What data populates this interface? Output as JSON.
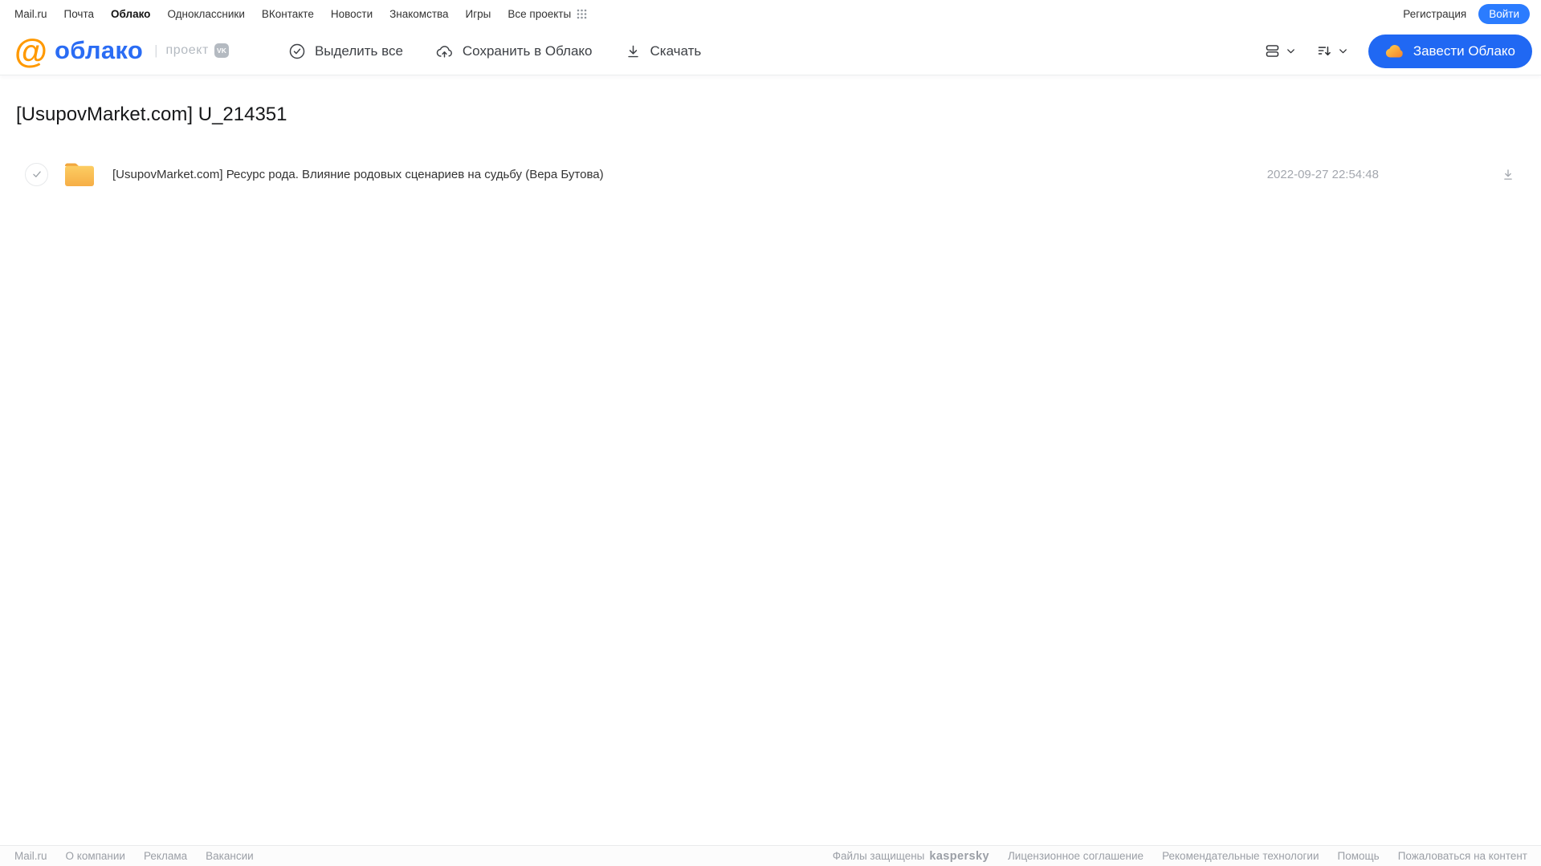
{
  "topnav": {
    "items": [
      "Mail.ru",
      "Почта",
      "Облако",
      "Одноклассники",
      "ВКонтакте",
      "Новости",
      "Знакомства",
      "Игры",
      "Все проекты"
    ],
    "registration": "Регистрация",
    "login": "Войти"
  },
  "header": {
    "logo": {
      "at": "@",
      "name": "облако",
      "divider": "|",
      "project": "проект",
      "vk": "VK"
    },
    "toolbar": {
      "select_all": "Выделить все",
      "save_to_cloud": "Сохранить в Облако",
      "download": "Скачать"
    },
    "create_cloud": "Завести Облако"
  },
  "main": {
    "title": "[UsupovMarket.com] U_214351",
    "files": [
      {
        "name": "[UsupovMarket.com] Ресурс рода. Влияние родовых сценариев на судьбу (Вера Бутова)",
        "date": "2022-09-27 22:54:48"
      }
    ]
  },
  "footer": {
    "left": [
      "Mail.ru",
      "О компании",
      "Реклама",
      "Вакансии"
    ],
    "protected_label": "Файлы защищены",
    "kaspersky": "kaspersky",
    "right": [
      "Лицензионное соглашение",
      "Рекомендательные технологии",
      "Помощь",
      "Пожаловаться на контент"
    ]
  },
  "colors": {
    "accent_blue": "#2068f3",
    "link_blue": "#2b7cff",
    "logo_blue": "#2a6cf4",
    "logo_orange": "#ff9900",
    "folder_yellow": "#f8bb4e",
    "kaspersky_green": "#00a88e"
  }
}
